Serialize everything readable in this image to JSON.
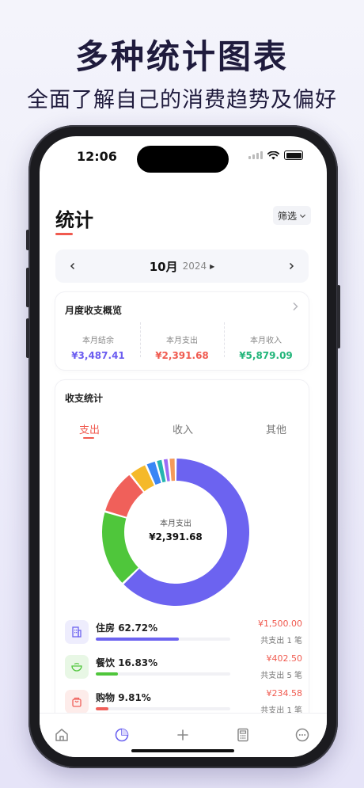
{
  "promo": {
    "title": "多种统计图表",
    "subtitle": "全面了解自己的消费趋势及偏好"
  },
  "status_bar": {
    "time": "12:06"
  },
  "header": {
    "title": "统计",
    "filter_label": "筛选"
  },
  "month_nav": {
    "month": "10月",
    "year": "2024"
  },
  "monthly_overview": {
    "title": "月度收支概览",
    "items": [
      {
        "label": "本月结余",
        "value": "¥3,487.41",
        "color": "#6a5cf0"
      },
      {
        "label": "本月支出",
        "value": "¥2,391.68",
        "color": "#f05a4f"
      },
      {
        "label": "本月收入",
        "value": "¥5,879.09",
        "color": "#22b57a"
      }
    ]
  },
  "stats": {
    "title": "收支统计",
    "tabs": [
      {
        "label": "支出",
        "active": true
      },
      {
        "label": "收入",
        "active": false
      },
      {
        "label": "其他",
        "active": false
      }
    ],
    "donut_center_label": "本月支出",
    "donut_center_value": "¥2,391.68",
    "categories": [
      {
        "name": "住房",
        "percent": "62.72%",
        "amount": "¥1,500.00",
        "count": "共支出 1 笔",
        "fraction": 0.6272,
        "color": "#6c63f0",
        "icon_bg": "#eeedfd",
        "icon": "building-icon"
      },
      {
        "name": "餐饮",
        "percent": "16.83%",
        "amount": "¥402.50",
        "count": "共支出 5 笔",
        "fraction": 0.1683,
        "color": "#4fc63b",
        "icon_bg": "#e8f7e5",
        "icon": "bowl-icon"
      },
      {
        "name": "购物",
        "percent": "9.81%",
        "amount": "¥234.58",
        "count": "共支出 1 笔",
        "fraction": 0.0981,
        "color": "#f0605a",
        "icon_bg": "#fdecea",
        "icon": "bag-icon"
      }
    ]
  },
  "chart_data": {
    "type": "pie",
    "title": "本月支出",
    "total": "¥2,391.68",
    "series": [
      {
        "name": "住房",
        "value": 62.72,
        "color": "#6c63f0"
      },
      {
        "name": "餐饮",
        "value": 16.83,
        "color": "#4fc63b"
      },
      {
        "name": "购物",
        "value": 9.81,
        "color": "#f0605a"
      },
      {
        "value": 4.0,
        "color": "#f5b92a"
      },
      {
        "value": 2.3,
        "color": "#3a86f5"
      },
      {
        "value": 1.5,
        "color": "#26b5b0"
      },
      {
        "value": 1.3,
        "color": "#9b6cf5"
      },
      {
        "value": 1.54,
        "color": "#f59a5a"
      }
    ]
  },
  "tabbar": {
    "items": [
      {
        "icon": "home-icon",
        "active": false
      },
      {
        "icon": "chart-icon",
        "active": true
      },
      {
        "icon": "plus-icon",
        "active": false
      },
      {
        "icon": "calculator-icon",
        "active": false
      },
      {
        "icon": "more-icon",
        "active": false
      }
    ]
  }
}
